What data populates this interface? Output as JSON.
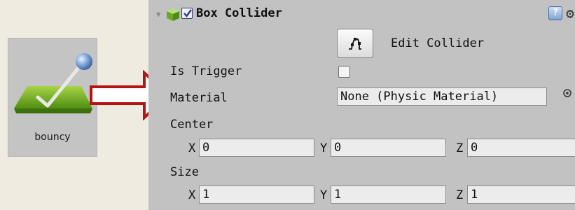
{
  "asset": {
    "name": "bouncy",
    "icon": "physic-material-icon"
  },
  "annotation": {
    "arrow_color": "#b31515"
  },
  "inspector": {
    "component_title": "Box Collider",
    "component_icon": "cube-icon",
    "enabled": true,
    "edit_collider_label": "Edit Collider",
    "properties": {
      "is_trigger": {
        "label": "Is Trigger",
        "checked": false
      },
      "material": {
        "label": "Material",
        "value": "None (Physic Material)"
      },
      "center": {
        "label": "Center",
        "x_label": "X",
        "x": "0",
        "y_label": "Y",
        "y": "0",
        "z_label": "Z",
        "z": "0"
      },
      "size": {
        "label": "Size",
        "x_label": "X",
        "x": "1",
        "y_label": "Y",
        "y": "1",
        "z_label": "Z",
        "z": "1"
      }
    }
  }
}
